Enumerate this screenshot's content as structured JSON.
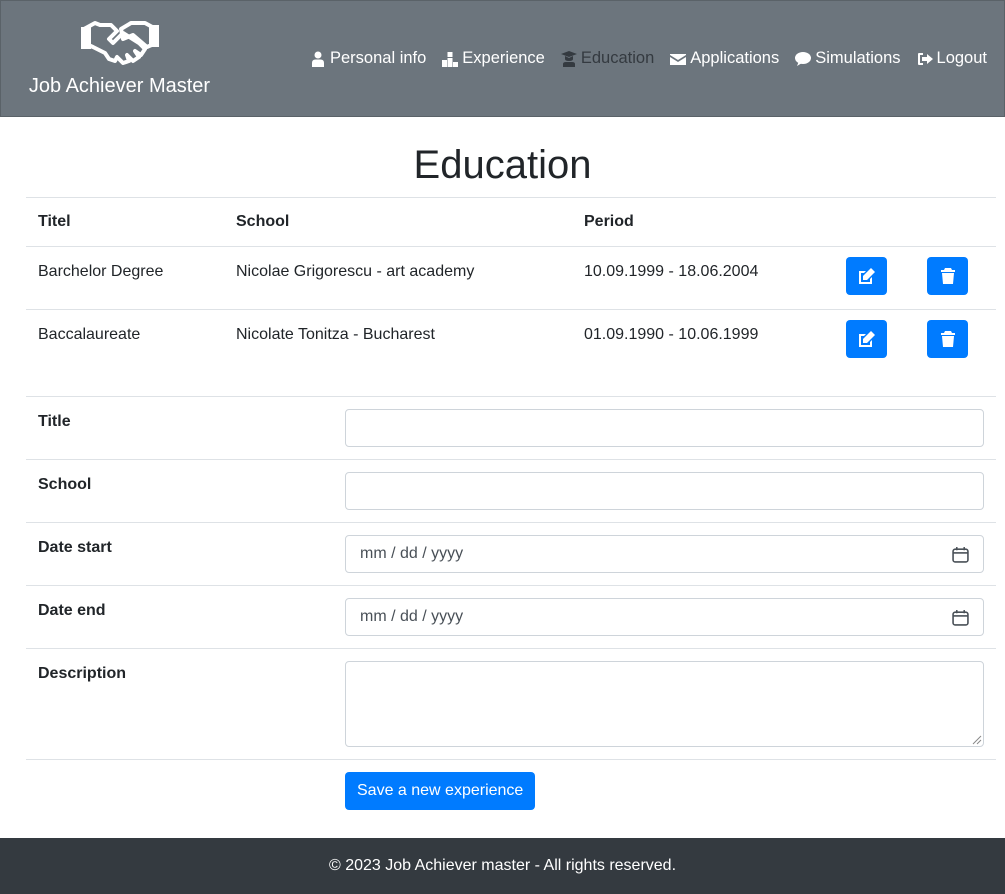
{
  "brand": {
    "name": "Job Achiever Master",
    "logo_icon": "handshake-icon"
  },
  "nav": [
    {
      "label": "Personal info",
      "icon": "user-icon"
    },
    {
      "label": "Experience",
      "icon": "podium-icon"
    },
    {
      "label": "Education",
      "icon": "graduate-icon",
      "active": true
    },
    {
      "label": "Applications",
      "icon": "envelope-icon"
    },
    {
      "label": "Simulations",
      "icon": "comment-icon"
    },
    {
      "label": "Logout",
      "icon": "sign-out-icon"
    }
  ],
  "page": {
    "title": "Education"
  },
  "table": {
    "headers": [
      "Titel",
      "School",
      "Period"
    ],
    "rows": [
      {
        "title": "Barchelor Degree",
        "school": "Nicolae Grigorescu - art academy",
        "period": "10.09.1999 - 18.06.2004"
      },
      {
        "title": "Baccalaureate",
        "school": "Nicolate Tonitza - Bucharest",
        "period": "01.09.1990 - 10.06.1999"
      }
    ],
    "edit_icon": "edit-icon",
    "delete_icon": "trash-icon"
  },
  "form": {
    "title_label": "Title",
    "title_value": "",
    "school_label": "School",
    "school_value": "",
    "date_start_label": "Date start",
    "date_start_placeholder": "mm / dd / yyyy",
    "date_end_label": "Date end",
    "date_end_placeholder": "mm / dd / yyyy",
    "description_label": "Description",
    "description_value": "",
    "save_label": "Save a new experience"
  },
  "footer": {
    "text": "© 2023 Job Achiever master - All rights reserved."
  },
  "colors": {
    "header_bg": "#6c757d",
    "accent": "#007bff",
    "footer_bg": "#343a40",
    "active_nav": "#343a40"
  }
}
